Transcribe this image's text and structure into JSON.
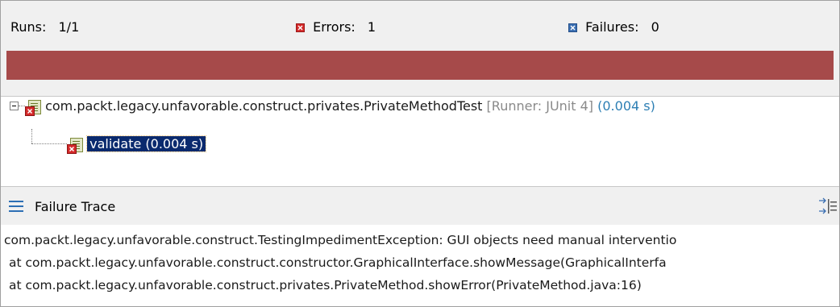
{
  "summary": {
    "runs_label": "Runs:",
    "runs_value": "1/1",
    "errors_label": "Errors:",
    "errors_value": "1",
    "failures_label": "Failures:",
    "failures_value": "0"
  },
  "progress": {
    "fraction": 1.0,
    "color": "#a64a4a",
    "status": "error"
  },
  "tree": {
    "suite": {
      "name": "com.packt.legacy.unfavorable.construct.privates.PrivateMethodTest",
      "runner": "[Runner: JUnit 4]",
      "time": "(0.004 s)",
      "icon": "test-suite-error-icon",
      "expanded": true
    },
    "tests": [
      {
        "label": "validate (0.004 s)",
        "icon": "test-error-icon",
        "selected": true
      }
    ]
  },
  "failure_trace": {
    "title": "Failure Trace",
    "lines": [
      "com.packt.legacy.unfavorable.construct.TestingImpedimentException: GUI objects need manual interventio",
      "at com.packt.legacy.unfavorable.construct.constructor.GraphicalInterface.showMessage(GraphicalInterfa",
      "at com.packt.legacy.unfavorable.construct.privates.PrivateMethod.showError(PrivateMethod.java:16)"
    ]
  },
  "colors": {
    "error_bar": "#a64a4a",
    "time_text": "#2d7fb4",
    "runner_text": "#8a8a8a",
    "selection": "#0a2a6e"
  }
}
